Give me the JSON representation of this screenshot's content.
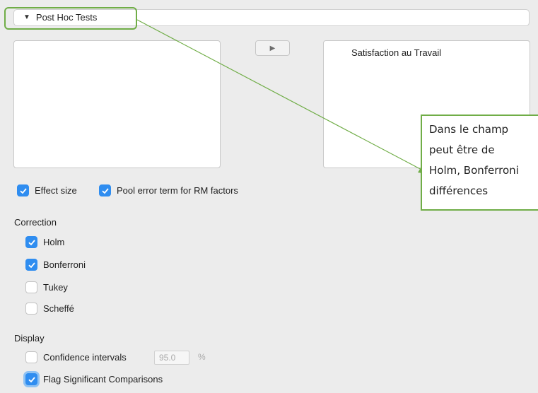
{
  "post_hoc": {
    "section_title": "Post Hoc Tests",
    "target_variables": [
      "Satisfaction au Travail"
    ]
  },
  "options": {
    "effect_size": {
      "label": "Effect size",
      "checked": true
    },
    "pool_error": {
      "label": "Pool error term for RM factors",
      "checked": true
    }
  },
  "correction": {
    "label": "Correction",
    "items": [
      {
        "label": "Holm",
        "checked": true
      },
      {
        "label": "Bonferroni",
        "checked": true
      },
      {
        "label": "Tukey",
        "checked": false
      },
      {
        "label": "Scheffé",
        "checked": false
      }
    ]
  },
  "display": {
    "label": "Display",
    "confidence_intervals": {
      "label": "Confidence intervals",
      "checked": false,
      "value": "95.0",
      "unit": "%"
    },
    "flag_significant": {
      "label": "Flag Significant Comparisons",
      "checked": true
    }
  },
  "annotation": {
    "text": "Dans le champ\npeut être de\nHolm, Bonferroni\ndifférences"
  },
  "colors": {
    "accent": "#2f8df0",
    "annotation_green": "#70ad47"
  }
}
